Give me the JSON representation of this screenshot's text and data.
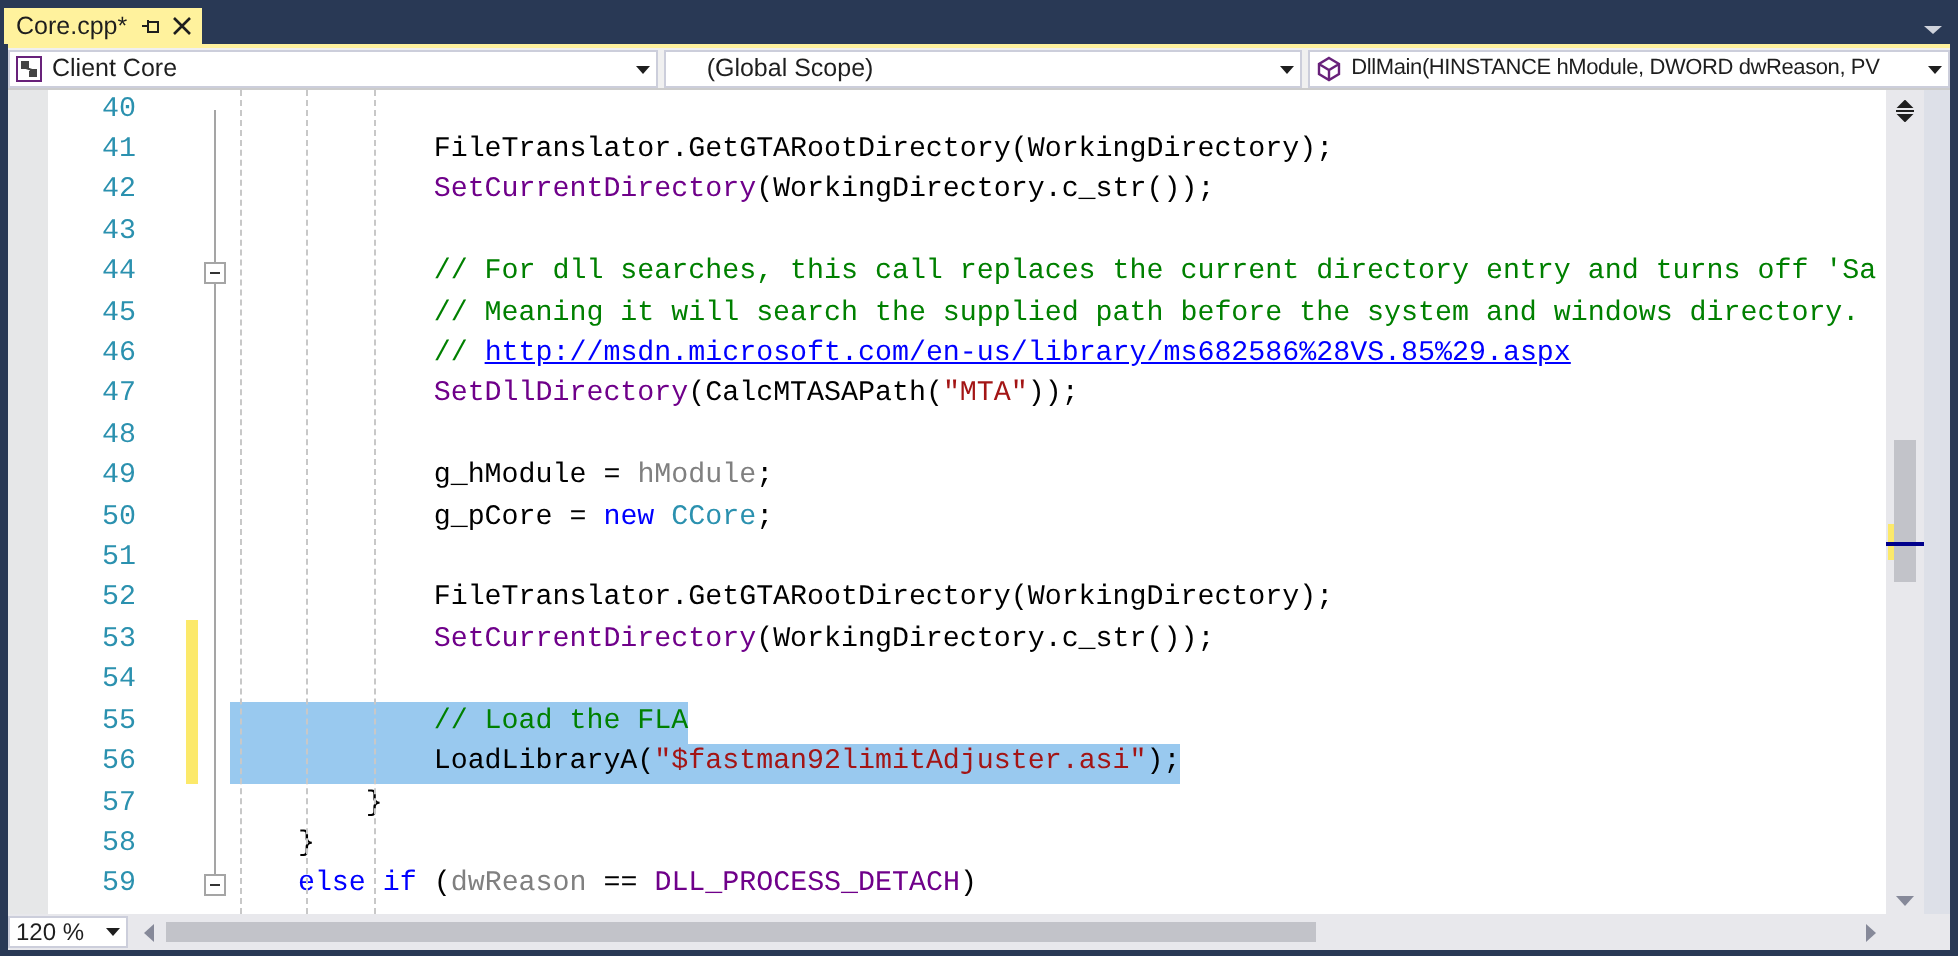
{
  "tabs": [
    {
      "label": "Core.cpp*",
      "selected": true
    }
  ],
  "navigation_bar": {
    "project": "Client Core",
    "scope": "(Global Scope)",
    "member": "DllMain(HINSTANCE hModule, DWORD dwReason, PV"
  },
  "lines": [
    {
      "number": "40",
      "changed": false,
      "selected": false,
      "collapsible": false
    },
    {
      "number": "41",
      "changed": false,
      "selected": false,
      "collapsible": false,
      "tokens": [
        {
          "kind": "plain",
          "text": "            FileTranslator.GetGTARootDirectory(WorkingDirectory);"
        }
      ]
    },
    {
      "number": "42",
      "changed": false,
      "selected": false,
      "collapsible": false,
      "tokens": [
        {
          "kind": "macro",
          "text": "            SetCurrentDirectory"
        },
        {
          "kind": "plain",
          "text": "(WorkingDirectory.c_str());"
        }
      ]
    },
    {
      "number": "43",
      "changed": false,
      "selected": false,
      "collapsible": false
    },
    {
      "number": "44",
      "changed": false,
      "selected": false,
      "collapsible": true,
      "tokens": [
        {
          "kind": "comment",
          "text": "            // For dll searches, this call replaces the current directory entry and turns off 'Sa"
        }
      ]
    },
    {
      "number": "45",
      "changed": false,
      "selected": false,
      "collapsible": false,
      "tokens": [
        {
          "kind": "comment",
          "text": "            // Meaning it will search the supplied path before the system and windows directory."
        }
      ]
    },
    {
      "number": "46",
      "changed": false,
      "selected": false,
      "collapsible": false,
      "tokens": [
        {
          "kind": "comment",
          "text": "            // "
        },
        {
          "kind": "link",
          "text": "http://msdn.microsoft.com/en-us/library/ms682586%28VS.85%29.aspx"
        }
      ]
    },
    {
      "number": "47",
      "changed": false,
      "selected": false,
      "collapsible": false,
      "tokens": [
        {
          "kind": "macro",
          "text": "            SetDllDirectory"
        },
        {
          "kind": "plain",
          "text": "(CalcMTASAPath("
        },
        {
          "kind": "string",
          "text": "\"MTA\""
        },
        {
          "kind": "plain",
          "text": "));"
        }
      ]
    },
    {
      "number": "48",
      "changed": false,
      "selected": false,
      "collapsible": false
    },
    {
      "number": "49",
      "changed": false,
      "selected": false,
      "collapsible": false,
      "tokens": [
        {
          "kind": "plain",
          "text": "            g_hModule = "
        },
        {
          "kind": "parameter",
          "text": "hModule"
        },
        {
          "kind": "plain",
          "text": ";"
        }
      ]
    },
    {
      "number": "50",
      "changed": false,
      "selected": false,
      "collapsible": false,
      "tokens": [
        {
          "kind": "plain",
          "text": "            g_pCore = "
        },
        {
          "kind": "keyword",
          "text": "new"
        },
        {
          "kind": "type",
          "text": " CCore"
        },
        {
          "kind": "plain",
          "text": ";"
        }
      ]
    },
    {
      "number": "51",
      "changed": false,
      "selected": false,
      "collapsible": false
    },
    {
      "number": "52",
      "changed": false,
      "selected": false,
      "collapsible": false,
      "tokens": [
        {
          "kind": "plain",
          "text": "            FileTranslator.GetGTARootDirectory(WorkingDirectory);"
        }
      ]
    },
    {
      "number": "53",
      "changed": true,
      "selected": false,
      "collapsible": false,
      "tokens": [
        {
          "kind": "macro",
          "text": "            SetCurrentDirectory"
        },
        {
          "kind": "plain",
          "text": "(WorkingDirectory.c_str());"
        }
      ]
    },
    {
      "number": "54",
      "changed": true,
      "selected": false,
      "collapsible": false
    },
    {
      "number": "55",
      "changed": true,
      "selected": true,
      "collapsible": false,
      "tokens": [
        {
          "kind": "comment",
          "text": "            // Load the FLA"
        }
      ]
    },
    {
      "number": "56",
      "changed": true,
      "selected": true,
      "collapsible": false,
      "tokens": [
        {
          "kind": "plain",
          "text": "            LoadLibraryA("
        },
        {
          "kind": "string",
          "text": "\"$fastman92limitAdjuster.asi\""
        },
        {
          "kind": "plain",
          "text": ");"
        }
      ]
    },
    {
      "number": "57",
      "changed": false,
      "selected": false,
      "collapsible": false,
      "tokens": [
        {
          "kind": "plain",
          "text": "        }"
        }
      ]
    },
    {
      "number": "58",
      "changed": false,
      "selected": false,
      "collapsible": false,
      "tokens": [
        {
          "kind": "plain",
          "text": "    }"
        }
      ]
    },
    {
      "number": "59",
      "changed": false,
      "selected": false,
      "collapsible": true,
      "tokens": [
        {
          "kind": "keyword",
          "text": "    else"
        },
        {
          "kind": "keyword",
          "text": " if"
        },
        {
          "kind": "plain",
          "text": " ("
        },
        {
          "kind": "parameter",
          "text": "dwReason"
        },
        {
          "kind": "plain",
          "text": " == "
        },
        {
          "kind": "macro",
          "text": "DLL_PROCESS_DETACH"
        },
        {
          "kind": "plain",
          "text": ")"
        }
      ]
    }
  ],
  "zoom": "120 %"
}
